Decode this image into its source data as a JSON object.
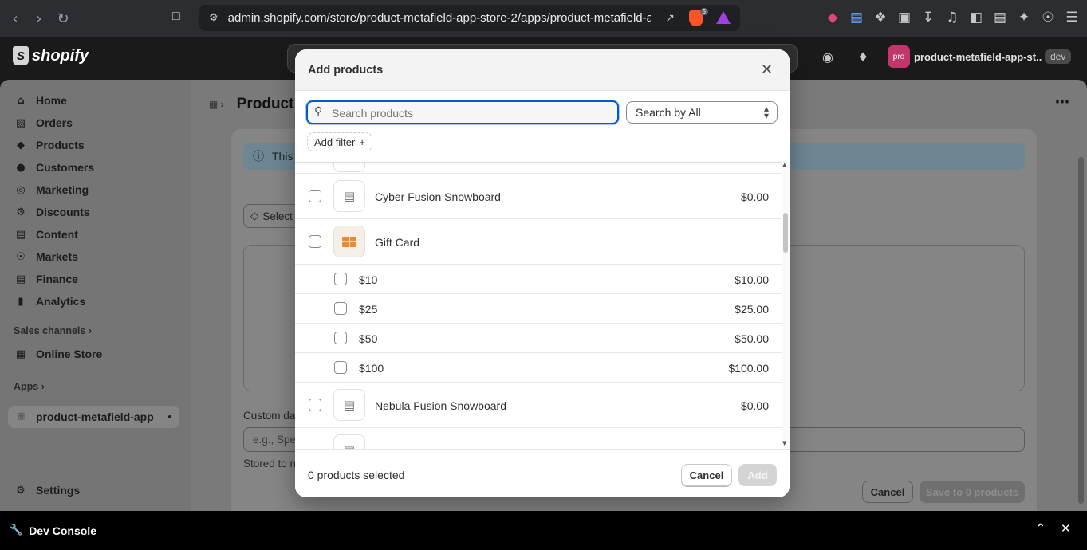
{
  "browser": {
    "url": "admin.shopify.com/store/product-metafield-app-store-2/apps/product-metafield-a...",
    "brave_count": "5"
  },
  "shop_bar": {
    "logo_text": "shopify",
    "store_avatar": "pro",
    "store_name": "product-metafield-app-st...",
    "env_badge": "dev"
  },
  "sidebar": {
    "items": [
      {
        "label": "Home",
        "icon": "home-icon"
      },
      {
        "label": "Orders",
        "icon": "orders-icon"
      },
      {
        "label": "Products",
        "icon": "products-icon"
      },
      {
        "label": "Customers",
        "icon": "customers-icon"
      },
      {
        "label": "Marketing",
        "icon": "marketing-icon"
      },
      {
        "label": "Discounts",
        "icon": "discounts-icon"
      },
      {
        "label": "Content",
        "icon": "content-icon"
      },
      {
        "label": "Markets",
        "icon": "markets-icon"
      },
      {
        "label": "Finance",
        "icon": "finance-icon"
      },
      {
        "label": "Analytics",
        "icon": "analytics-icon"
      }
    ],
    "sales_channels_label": "Sales channels",
    "online_store_label": "Online Store",
    "apps_label": "Apps",
    "app_name": "product-metafield-app",
    "settings_label": "Settings"
  },
  "page": {
    "title": "Product r",
    "banner_text": "This",
    "select_button": "Select",
    "custom_label": "Custom da",
    "custom_placeholder": "e.g., Spe",
    "stored_text": "Stored to n",
    "cancel_label": "Cancel",
    "save_label": "Save to 0 products"
  },
  "dev_console": {
    "label": "Dev Console"
  },
  "modal": {
    "title": "Add products",
    "search_placeholder": "Search products",
    "search_value": "",
    "search_by": "Search by All",
    "add_filter": "Add filter",
    "products": [
      {
        "name": "Cyber Fusion Snowboard",
        "price": "$0.00",
        "variants": []
      },
      {
        "name": "Gift Card",
        "price": "",
        "variants": [
          {
            "name": "$10",
            "price": "$10.00"
          },
          {
            "name": "$25",
            "price": "$25.00"
          },
          {
            "name": "$50",
            "price": "$50.00"
          },
          {
            "name": "$100",
            "price": "$100.00"
          }
        ]
      },
      {
        "name": "Nebula Fusion Snowboard",
        "price": "$0.00",
        "variants": []
      }
    ],
    "selected_count": "0 products selected",
    "cancel_label": "Cancel",
    "add_label": "Add"
  },
  "colors": {
    "primary_focus": "#005bd3",
    "shopify_dark": "#1a1a1a",
    "store_avatar": "#c2366b"
  }
}
